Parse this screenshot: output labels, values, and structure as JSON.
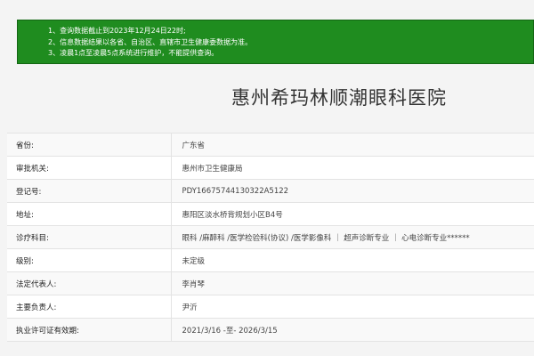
{
  "notice": {
    "lines": [
      "1、查询数据截止到2023年12月24日22时;",
      "2、信息数据结果以各省、自治区、直辖市卫生健康委数据为准。",
      "3、凌晨1点至凌晨5点系统进行维护，不能提供查询。"
    ]
  },
  "hospital": {
    "name": "惠州希玛林顺潮眼科医院"
  },
  "details": [
    {
      "label": "省份:",
      "value": "广东省"
    },
    {
      "label": "审批机关:",
      "value": "惠州市卫生健康局"
    },
    {
      "label": "登记号:",
      "value": "PDY16675744130322A5122"
    },
    {
      "label": "地址:",
      "value": "惠阳区淡水桥背规划小区B4号"
    },
    {
      "label": "诊疗科目:",
      "value": "眼科 /麻醉科 /医学检验科(协议) /医学影像科 ｜ 超声诊断专业 ｜ 心电诊断专业******"
    },
    {
      "label": "级别:",
      "value": "未定级"
    },
    {
      "label": "法定代表人:",
      "value": "李肖琴"
    },
    {
      "label": "主要负责人:",
      "value": "尹沂"
    },
    {
      "label": "执业许可证有效期:",
      "value": "2021/3/16 -至- 2026/3/15"
    }
  ]
}
